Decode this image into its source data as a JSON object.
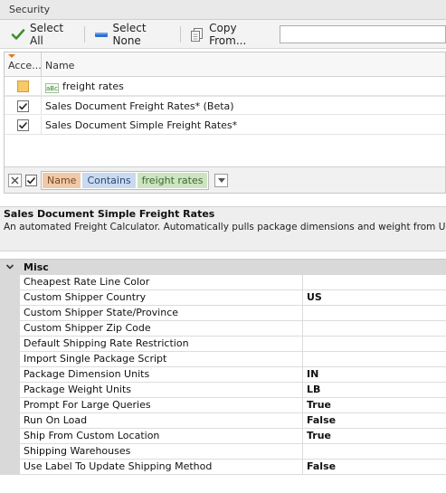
{
  "group": {
    "title": "Security"
  },
  "toolbar": {
    "select_all": "Select All",
    "select_none": "Select None",
    "copy_from": "Copy From...",
    "search_value": ""
  },
  "grid": {
    "columns": {
      "access": "Acce...",
      "name": "Name"
    },
    "filter_row": {
      "value": "freight rates",
      "icon": "abc-filter-icon"
    },
    "rows": [
      {
        "checked": true,
        "name": "Sales Document Freight Rates* (Beta)"
      },
      {
        "checked": true,
        "name": "Sales Document Simple Freight Rates*"
      }
    ],
    "filter_bar": {
      "field": "Name",
      "operator": "Contains",
      "value": "freight rates"
    }
  },
  "description": {
    "title": "Sales Document Simple Freight Rates",
    "text": "An automated Freight Calculator.  Automatically pulls package dimensions and weight from UDFs, and c"
  },
  "properties": {
    "category": "Misc",
    "items": [
      {
        "name": "Cheapest Rate Line Color",
        "value": ""
      },
      {
        "name": "Custom Shipper Country",
        "value": "US"
      },
      {
        "name": "Custom Shipper State/Province",
        "value": ""
      },
      {
        "name": "Custom Shipper Zip Code",
        "value": ""
      },
      {
        "name": "Default Shipping Rate Restriction",
        "value": ""
      },
      {
        "name": "Import Single Package Script",
        "value": ""
      },
      {
        "name": "Package Dimension Units",
        "value": "IN"
      },
      {
        "name": "Package Weight Units",
        "value": "LB"
      },
      {
        "name": "Prompt For Large Queries",
        "value": "True"
      },
      {
        "name": "Run On Load",
        "value": "False"
      },
      {
        "name": "Ship From Custom Location",
        "value": "True"
      },
      {
        "name": "Shipping Warehouses",
        "value": ""
      },
      {
        "name": "Use Label To Update Shipping Method",
        "value": "False"
      }
    ]
  },
  "colors": {
    "accent_check": "#3d8f2f",
    "select_none_blue": "#2f6fd1",
    "filter_orange": "#e07a1e"
  }
}
